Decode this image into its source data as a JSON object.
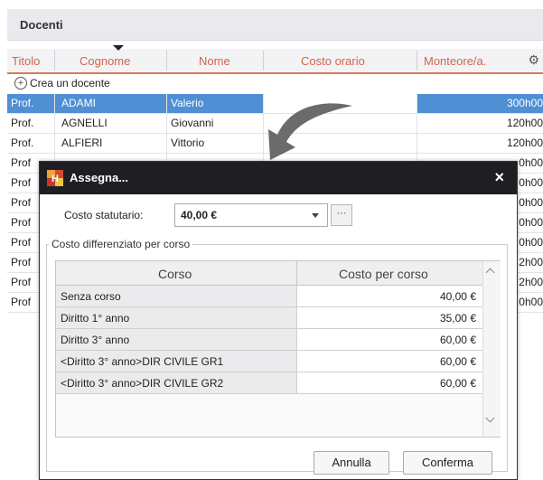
{
  "panel": {
    "title": "Docenti",
    "columns": [
      "Titolo",
      "Cognome",
      "Nome",
      "Costo orario",
      "Monteore/a."
    ],
    "create_label": "Crea un docente",
    "rows": [
      {
        "titolo": "Prof.",
        "cognome": "ADAMI",
        "nome": "Valerio",
        "monteore": "300h00",
        "selected": true
      },
      {
        "titolo": "Prof.",
        "cognome": "AGNELLI",
        "nome": "Giovanni",
        "monteore": "120h00"
      },
      {
        "titolo": "Prof.",
        "cognome": "ALFIERI",
        "nome": "Vittorio",
        "monteore": "120h00"
      },
      {
        "titolo": "Prof",
        "monteore": "0h00"
      },
      {
        "titolo": "Prof",
        "monteore": "0h00"
      },
      {
        "titolo": "Prof",
        "monteore": "0h00"
      },
      {
        "titolo": "Prof",
        "monteore": "0h00"
      },
      {
        "titolo": "Prof",
        "monteore": "0h00"
      },
      {
        "titolo": "Prof",
        "monteore": "2h00"
      },
      {
        "titolo": "Prof",
        "monteore": "2h00"
      },
      {
        "titolo": "Prof",
        "monteore": "0h00"
      }
    ]
  },
  "dialog": {
    "title": "Assegna...",
    "close": "×",
    "costo_statutario_label": "Costo statutario:",
    "costo_statutario_value": "40,00 €",
    "more_label": "···",
    "group_label": "Costo differenziato per corso",
    "table_headers": {
      "corso": "Corso",
      "costo": "Costo per corso"
    },
    "table_rows": [
      {
        "corso": "Senza corso",
        "costo": "40,00 €"
      },
      {
        "corso": "Diritto 1° anno",
        "costo": "35,00 €"
      },
      {
        "corso": "Diritto 3° anno",
        "costo": "60,00 €"
      },
      {
        "corso": "<Diritto 3° anno>DIR CIVILE GR1",
        "costo": "60,00 €"
      },
      {
        "corso": "<Diritto 3° anno>DIR CIVILE GR2",
        "costo": "60,00 €"
      }
    ],
    "buttons": {
      "annulla": "Annulla",
      "conferma": "Conferma"
    }
  },
  "colors": {
    "accent": "#d0644b",
    "selection": "#4f8fd4",
    "titlebar": "#1f1f23"
  }
}
